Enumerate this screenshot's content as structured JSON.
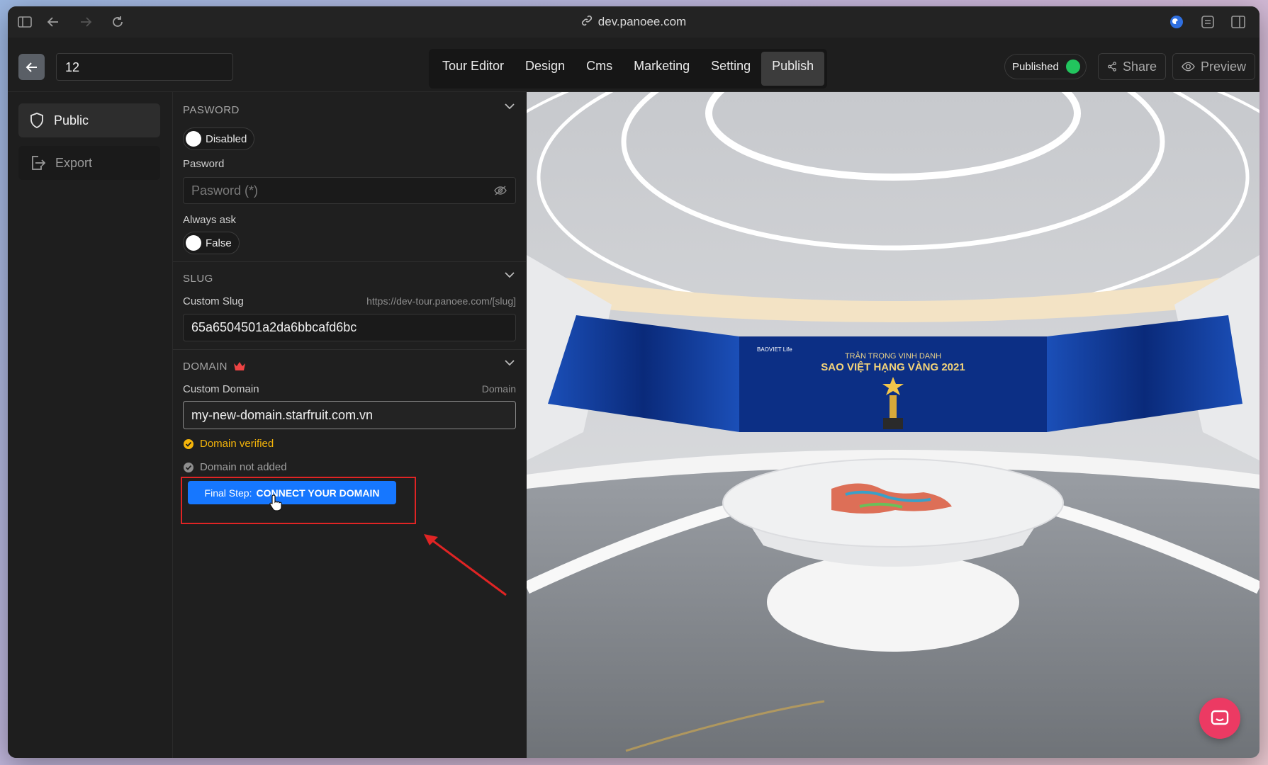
{
  "browser": {
    "url": "dev.panoee.com"
  },
  "header": {
    "project_name": "12",
    "tabs": [
      {
        "label": "Tour Editor"
      },
      {
        "label": "Design"
      },
      {
        "label": "Cms"
      },
      {
        "label": "Marketing"
      },
      {
        "label": "Setting"
      },
      {
        "label": "Publish",
        "active": true
      }
    ],
    "published_label": "Published",
    "share_label": "Share",
    "preview_label": "Preview"
  },
  "sidebar": {
    "items": [
      {
        "label": "Public",
        "icon": "shield-icon",
        "active": true
      },
      {
        "label": "Export",
        "icon": "export-icon",
        "active": false
      }
    ]
  },
  "password_section": {
    "title": "PASWORD",
    "toggle_label": "Disabled",
    "password_label": "Pasword",
    "password_placeholder": "Pasword (*)",
    "always_ask_label": "Always ask",
    "always_ask_value": "False"
  },
  "slug_section": {
    "title": "SLUG",
    "custom_slug_label": "Custom Slug",
    "slug_hint": "https://dev-tour.panoee.com/[slug]",
    "slug_value": "65a6504501a2da6bbcafd6bc"
  },
  "domain_section": {
    "title": "DOMAIN",
    "custom_domain_label": "Custom Domain",
    "domain_hint": "Domain",
    "domain_value": "my-new-domain.starfruit.com.vn",
    "status_verified": "Domain verified",
    "status_not_added": "Domain not added",
    "final_step_prefix": "Final Step:",
    "final_step_action": "CONNECT YOUR DOMAIN"
  },
  "preview_scene": {
    "screen_line1": "TRÂN TRỌNG VINH DANH",
    "screen_line2": "SAO VIỆT HẠNG VÀNG 2021",
    "screen_brand": "BAOVIET Life"
  },
  "colors": {
    "accent_blue": "#1677ff",
    "published_green": "#22c55e",
    "verified_yellow": "#f5b50a",
    "annotation_red": "#e02424",
    "chat_pink": "#ec3a63"
  }
}
